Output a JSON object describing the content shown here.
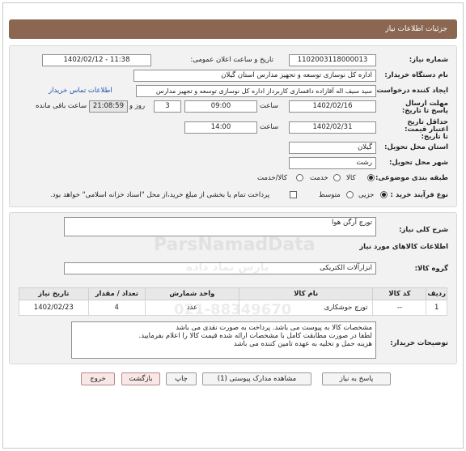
{
  "header": {
    "title": "جزئیات اطلاعات نیاز"
  },
  "fields": {
    "need_number_label": "شماره نیاز:",
    "need_number": "1102003118000013",
    "announce_label": "تاریخ و ساعت اعلان عمومی:",
    "announce_value": "1402/02/12 - 11:38",
    "buyer_label": "نام دستگاه خریدار:",
    "buyer_value": "اداره کل نوسازی  توسعه و تجهیز مدارس استان گیلان",
    "creator_label": "ایجاد کننده درخواست:",
    "creator_value": "سید سیف اله آقازاده دافساری کاربرداز اداره کل نوسازی  توسعه و تجهیز مدارس",
    "contact_link": "اطلاعات تماس خریدار",
    "deadline_label": "مهلت ارسال پاسخ تا تاریخ:",
    "deadline_date": "1402/02/16",
    "time_word": "ساعت",
    "deadline_time": "09:00",
    "days_count": "3",
    "days_word": "روز و",
    "remaining_time": "21:08:59",
    "remaining_word": "ساعت باقی مانده",
    "validity_label": "حداقل تاریخ اعتبار قیمت: تا تاریخ:",
    "validity_date": "1402/02/31",
    "validity_time": "14:00",
    "province_label": "استان محل تحویل:",
    "province_value": "گیلان",
    "city_label": "شهر محل تحویل:",
    "city_value": "رشت",
    "category_label": "طبقه بندی موضوعی:",
    "category_options": [
      "کالا",
      "خدمت",
      "کالا/خدمت"
    ],
    "process_label": "نوع فرآیند خرید :",
    "process_options": [
      "جزیی",
      "متوسط"
    ],
    "payment_note": "پرداخت تمام یا بخشی از مبلغ خرید،از محل \"اسناد خزانه اسلامی\" خواهد بود."
  },
  "summary": {
    "label": "شرح کلی نیاز:",
    "value": "تورچ آرگن هوا"
  },
  "goods": {
    "section_title": "اطلاعات کالاهای مورد نیاز",
    "group_label": "گروه کالا:",
    "group_value": "ابزارآلات الکتریکی",
    "columns": [
      "ردیف",
      "کد کالا",
      "نام کالا",
      "واحد شمارش",
      "تعداد / مقدار",
      "تاریخ نیاز"
    ],
    "rows": [
      [
        "1",
        "--",
        "تورچ جوشکاری",
        "عدد",
        "4",
        "1402/02/23"
      ]
    ]
  },
  "buyer_notes": {
    "label": "توضیحات خریدار:",
    "lines": [
      "مشخصات کالا به پیوست می باشد. پرداخت به صورت نقدی می باشد",
      "لطفا در صورت مطابقت کامل با مشخصات ارائه شده قیمت کالا را اعلام بفرمایید.",
      "هزینه حمل و تخلیه به عهده تامین کننده می باشد"
    ]
  },
  "buttons": {
    "reply": "پاسخ به نیاز",
    "attachments": "مشاهده مدارک پیوستی (1)",
    "print": "چاپ",
    "back": "بازگشت",
    "exit": "خروج"
  },
  "watermark": {
    "brand": "ParsNamadData",
    "brand_fa": "پارس نماد داده",
    "phone": "021-88349670"
  }
}
